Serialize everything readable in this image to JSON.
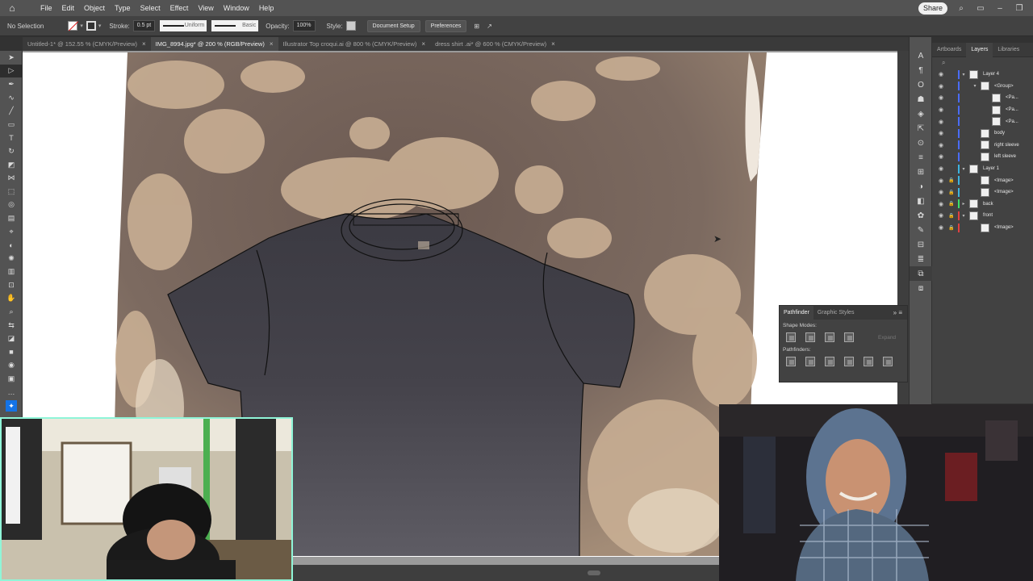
{
  "menubar": {
    "items": [
      "File",
      "Edit",
      "Object",
      "Type",
      "Select",
      "Effect",
      "View",
      "Window",
      "Help"
    ],
    "share_label": "Share"
  },
  "controlbar": {
    "selection_label": "No Selection",
    "stroke_label": "Stroke:",
    "stroke_weight": "0.5 pt",
    "profile_label": "Uniform",
    "brush_label": "Basic",
    "opacity_label": "Opacity:",
    "opacity_value": "100%",
    "style_label": "Style:",
    "document_setup_label": "Document Setup",
    "preferences_label": "Preferences"
  },
  "tabs": [
    {
      "label": "Untitled-1* @ 152.55 % (CMYK/Preview)",
      "active": false
    },
    {
      "label": "IMG_8994.jpg* @ 200 % (RGB/Preview)",
      "active": true
    },
    {
      "label": "Illustrator Top croqui.ai @ 800 % (CMYK/Preview)",
      "active": false
    },
    {
      "label": "dress shirt .ai* @ 600 % (CMYK/Preview)",
      "active": false
    }
  ],
  "layers_panel": {
    "tabs": [
      "Artboards",
      "Layers",
      "Libraries"
    ],
    "active_tab": "Layers",
    "rows": [
      {
        "name": "Layer 4",
        "indent": 0,
        "toggle": "▾",
        "color": "#4a6cf7",
        "lock": false
      },
      {
        "name": "<Group>",
        "indent": 1,
        "toggle": "▾",
        "color": "#4a6cf7",
        "lock": false
      },
      {
        "name": "<Pa...",
        "indent": 2,
        "toggle": "",
        "color": "#4a6cf7",
        "lock": false
      },
      {
        "name": "<Pa...",
        "indent": 2,
        "toggle": "",
        "color": "#4a6cf7",
        "lock": false
      },
      {
        "name": "<Pa...",
        "indent": 2,
        "toggle": "",
        "color": "#4a6cf7",
        "lock": false
      },
      {
        "name": "body",
        "indent": 1,
        "toggle": "",
        "color": "#4a6cf7",
        "lock": false
      },
      {
        "name": "right sleeve",
        "indent": 1,
        "toggle": "",
        "color": "#4a6cf7",
        "lock": false
      },
      {
        "name": "left sleeve",
        "indent": 1,
        "toggle": "",
        "color": "#4a6cf7",
        "lock": false
      },
      {
        "name": "Layer 1",
        "indent": 0,
        "toggle": "▾",
        "color": "#3cb4e0",
        "lock": false
      },
      {
        "name": "<Image>",
        "indent": 1,
        "toggle": "",
        "color": "#3cb4e0",
        "lock": true
      },
      {
        "name": "<Image>",
        "indent": 1,
        "toggle": "",
        "color": "#3cb4e0",
        "lock": true
      },
      {
        "name": "back",
        "indent": 0,
        "toggle": "▸",
        "color": "#3ce068",
        "lock": true
      },
      {
        "name": "front",
        "indent": 0,
        "toggle": "▾",
        "color": "#e04040",
        "lock": true
      },
      {
        "name": "<Image>",
        "indent": 1,
        "toggle": "",
        "color": "#e04040",
        "lock": true
      }
    ]
  },
  "pathfinder": {
    "tabs": [
      "Pathfinder",
      "Graphic Styles"
    ],
    "shape_modes_label": "Shape Modes:",
    "pathfinders_label": "Pathfinders:",
    "expand_label": "Expand"
  }
}
